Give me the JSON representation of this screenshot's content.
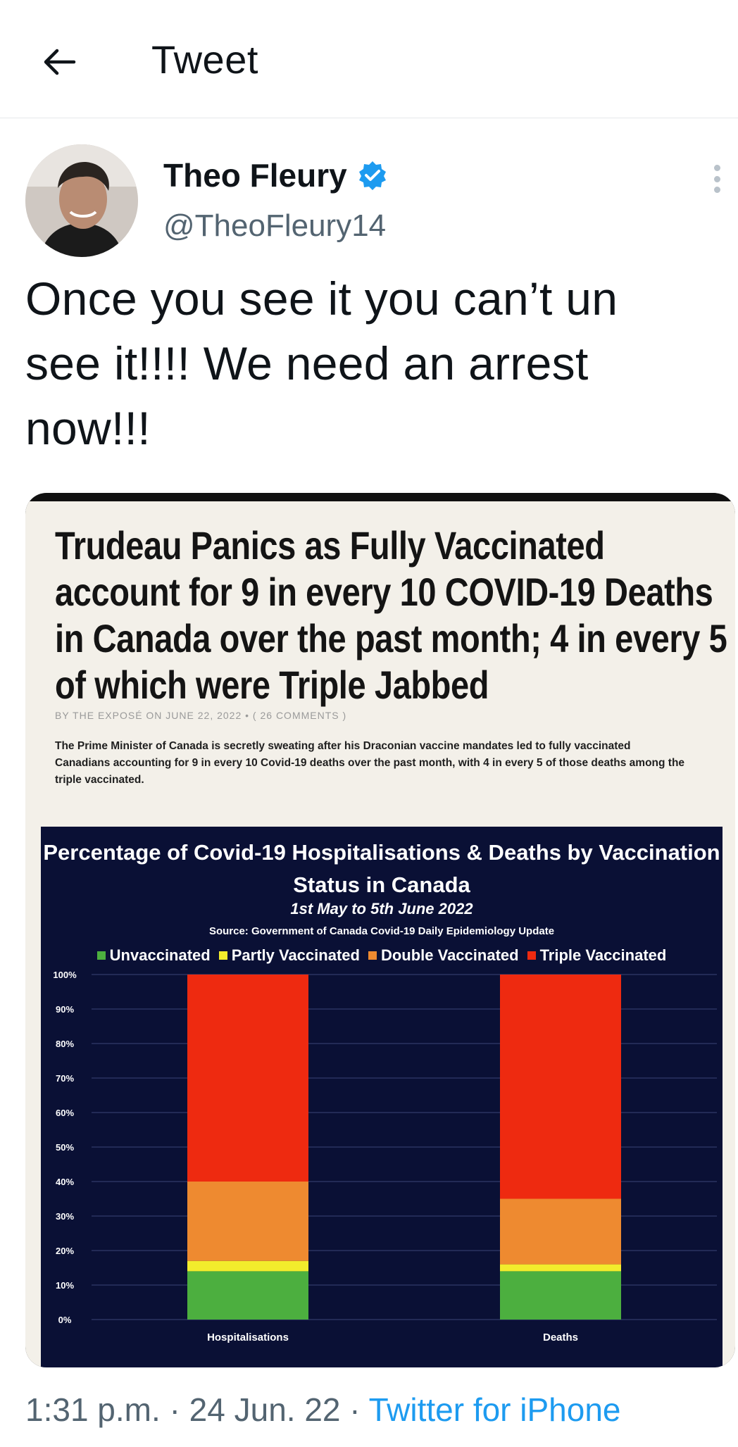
{
  "header": {
    "title": "Tweet",
    "back_icon": "arrow-left-icon"
  },
  "author": {
    "name": "Theo Fleury",
    "handle": "@TheoFleury14",
    "verified": true,
    "verified_color": "#1d9bf0"
  },
  "tweet": {
    "text": "Once you see it you can’t un see it!!!! We need an arrest now!!!"
  },
  "media": {
    "headline": "Trudeau Panics as Fully Vaccinated account for 9 in every 10 COVID-19 Deaths in Canada over the past month; 4 in every 5 of which were Triple Jabbed",
    "byline": "BY THE EXPOSÉ ON JUNE 22, 2022 • ( 26 COMMENTS )",
    "summary": "The Prime Minister of Canada is secretly sweating after his Draconian vaccine mandates led to fully vaccinated Canadians accounting for 9 in every 10 Covid-19 deaths over the past month, with 4 in every 5 of those deaths among the triple vaccinated."
  },
  "chart_data": {
    "type": "bar",
    "stacked": true,
    "title": "Percentage of Covid-19 Hospitalisations & Deaths by Vaccination Status in Canada",
    "subtitle": "1st May to 5th June 2022",
    "source": "Source: Government of Canada Covid-19 Daily Epidemiology Update",
    "categories": [
      "Hospitalisations",
      "Deaths"
    ],
    "series": [
      {
        "name": "Unvaccinated",
        "color": "#4caf3f",
        "values": [
          14,
          14
        ]
      },
      {
        "name": "Partly Vaccinated",
        "color": "#f2ec2c",
        "values": [
          3,
          2
        ]
      },
      {
        "name": "Double Vaccinated",
        "color": "#ee8a30",
        "values": [
          23,
          19
        ]
      },
      {
        "name": "Triple Vaccinated",
        "color": "#ee2a10",
        "values": [
          60,
          65
        ]
      }
    ],
    "yticks": [
      "0%",
      "10%",
      "20%",
      "30%",
      "40%",
      "50%",
      "60%",
      "70%",
      "80%",
      "90%",
      "100%"
    ],
    "ylim": [
      0,
      100
    ],
    "grid": true,
    "legend_position": "top"
  },
  "footer": {
    "time": "1:31 p.m.",
    "date": "24 Jun. 22",
    "sep": "·",
    "client": "Twitter for iPhone",
    "client_color": "#1d9bf0"
  }
}
